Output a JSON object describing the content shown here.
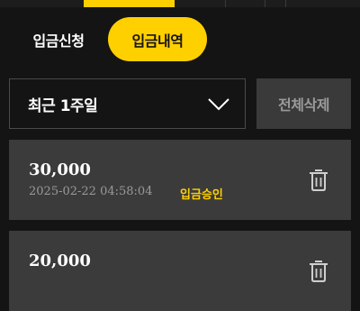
{
  "tabs": {
    "apply_label": "입금신청",
    "history_label": "입금내역"
  },
  "filter": {
    "period_selected": "최근 1주일",
    "delete_all_label": "전체삭제"
  },
  "deposits": [
    {
      "amount": "30,000",
      "datetime": "2025-02-22 04:58:04",
      "status": "입금승인"
    },
    {
      "amount": "20,000"
    }
  ],
  "colors": {
    "accent": "#ffd000",
    "background": "#141414",
    "card": "#3b3b3b",
    "muted_text": "#9a9a9a"
  },
  "icons": {
    "dropdown": "chevron-down-icon",
    "delete": "trash-icon"
  }
}
